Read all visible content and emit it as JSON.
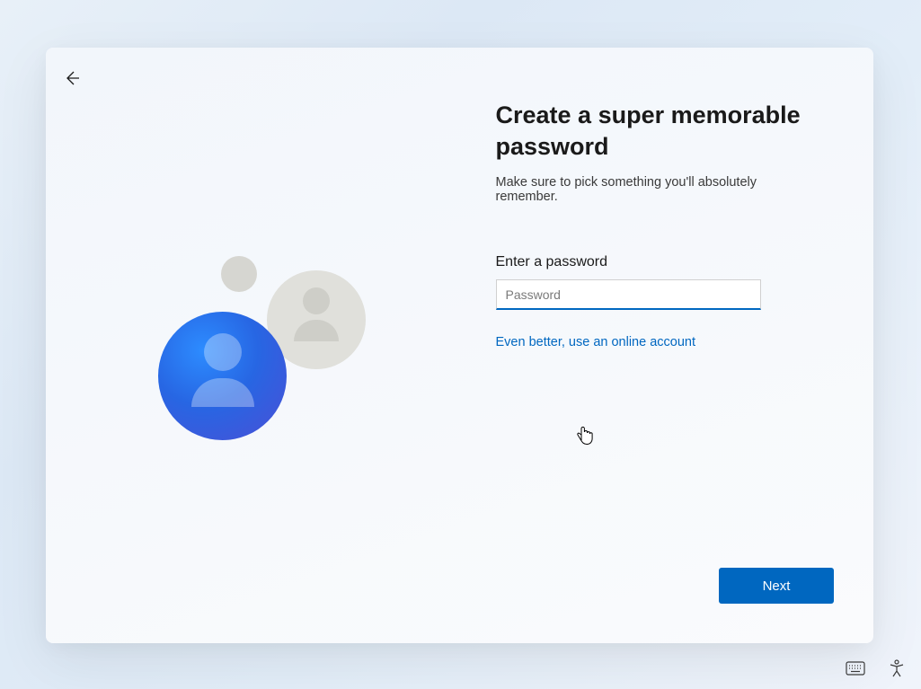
{
  "title": "Create a super memorable password",
  "subtitle": "Make sure to pick something you'll absolutely remember.",
  "fieldLabel": "Enter a password",
  "passwordPlaceholder": "Password",
  "passwordValue": "",
  "onlineLink": "Even better, use an online account",
  "nextLabel": "Next",
  "colors": {
    "accent": "#0067c0",
    "link": "#0067c0"
  }
}
